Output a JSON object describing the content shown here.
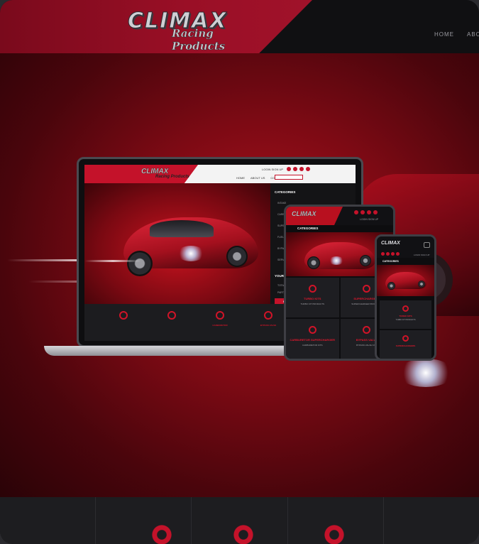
{
  "brand": {
    "name": "CLIMAX",
    "tagline": "Racing Products",
    "accent": "#c4122a",
    "dark": "#1c1c1f"
  },
  "header": {
    "nav": [
      "HOME",
      "ABOUT US"
    ]
  },
  "laptop": {
    "login": "LOGIN  SIGN UP",
    "nav": [
      "HOME",
      "ABOUT US",
      "CONTACT US"
    ],
    "sidebar_title": "CATEGORIES",
    "sidebar_items": [
      "INTAKE",
      "CARBURETOR SUPERCHARGER",
      "SUPERCHARGER",
      "FUEL INJECTED",
      "BYPASS VALVE",
      "SERVICE PARTS"
    ],
    "sidebar_title2": "YOUR CAR",
    "sidebar_fields": [
      "TOTAL PRODUCTS",
      "PART NUMBER"
    ],
    "sidebar_button": "SHOW",
    "categories": [
      "",
      "",
      "CARBURETOR",
      "BYPASS VALVE",
      ""
    ]
  },
  "tablet": {
    "login": "LOGIN  SIGN UP",
    "categories_title": "CATEGORIES",
    "cells": [
      {
        "title": "TURBO KITS",
        "sub": "TURBO KIT PRODUCTS"
      },
      {
        "title": "SUPERCHARGERS",
        "sub": "SUPERCHARGER PRODUCTS"
      },
      {
        "title": "CARBURETOR SUPERCHARGER",
        "sub": "CARBURETOR KITS"
      },
      {
        "title": "BYPASS VALVE",
        "sub": "BYPASS VALVE KITS"
      }
    ]
  },
  "phone": {
    "login": "LOGIN  SIGN UP",
    "categories_title": "CATEGORIES",
    "cells": [
      {
        "title": "TURBO KITS",
        "sub": "TURBO KIT PRODUCTS"
      },
      {
        "title": "SUPERCHARGERS",
        "sub": ""
      }
    ]
  },
  "bottom_icons": [
    "turbo-icon",
    "supercharger-icon",
    "blower-icon"
  ]
}
